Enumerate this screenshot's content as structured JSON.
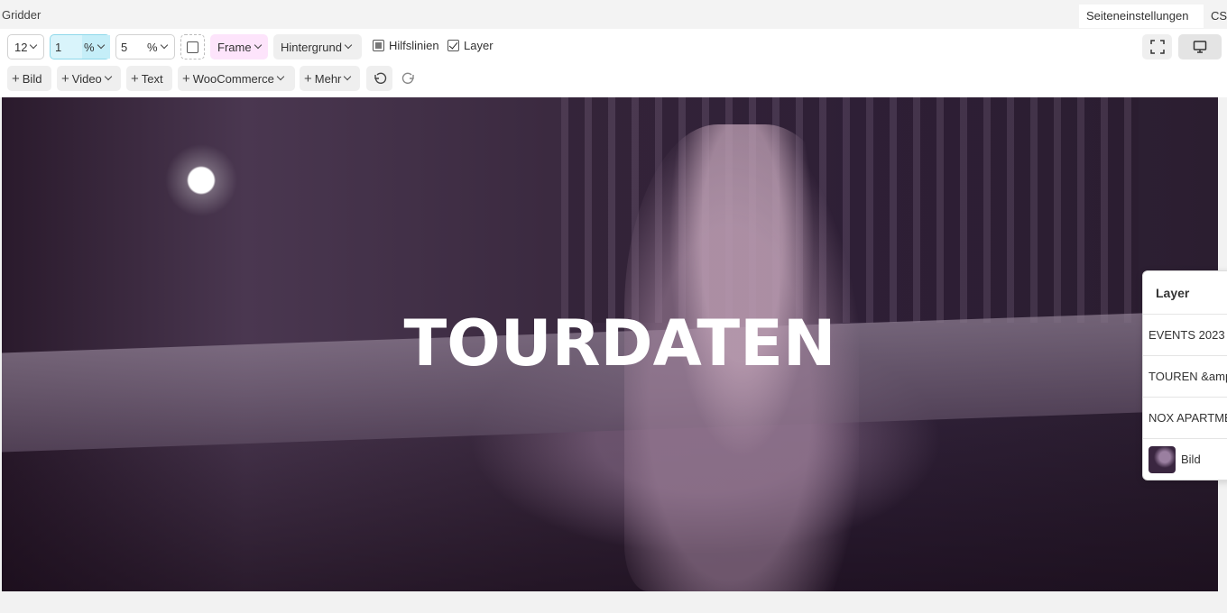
{
  "app": {
    "title": "Gridder"
  },
  "tabs": {
    "page_settings": "Seiteneinstellungen",
    "css": "CS"
  },
  "toolbar": {
    "columns": "12",
    "gap_value": "1",
    "gap_unit": "%",
    "padding_value": "5",
    "padding_unit": "%",
    "frame_label": "Frame",
    "background_label": "Hintergrund",
    "guides_label": "Hilfslinien",
    "guides_checked": true,
    "layer_label": "Layer",
    "layer_checked": true,
    "add_image": "Bild",
    "add_video": "Video",
    "add_text": "Text",
    "add_woocommerce": "WooCommerce",
    "add_more": "Mehr"
  },
  "canvas": {
    "headline": "TOURDATEN"
  },
  "layer_panel": {
    "title": "Layer",
    "items": [
      "EVENTS 2023",
      "TOUREN &amp;",
      "NOX APARTMENT",
      "Bild"
    ]
  },
  "colors": {
    "gap_highlight": "#d9f4fb",
    "frame_highlight": "#fde4fb",
    "canvas_tint": "#3b2a40"
  }
}
